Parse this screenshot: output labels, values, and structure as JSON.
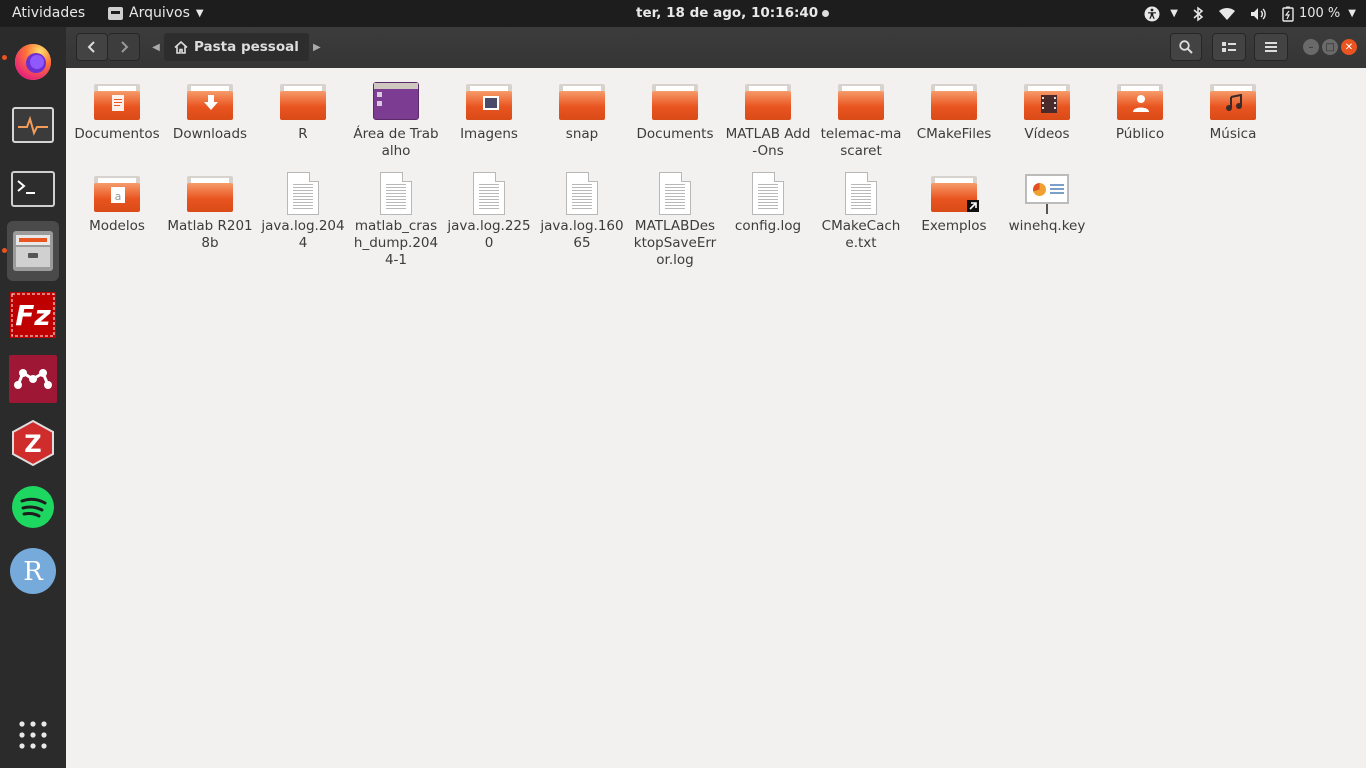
{
  "topbar": {
    "activities": "Atividades",
    "app_name": "Arquivos",
    "clock": "ter, 18 de ago, 10:16:40",
    "battery": "100 %"
  },
  "headerbar": {
    "location": "Pasta pessoal"
  },
  "dock": {
    "apps": [
      "firefox",
      "system-monitor",
      "terminal",
      "files",
      "filezilla",
      "mendeley",
      "zotero",
      "spotify",
      "rstudio",
      "show-applications"
    ]
  },
  "files": [
    {
      "name": "Documentos",
      "kind": "folder-documents"
    },
    {
      "name": "Downloads",
      "kind": "folder-downloads"
    },
    {
      "name": "R",
      "kind": "folder"
    },
    {
      "name": "Área de Trabalho",
      "kind": "desktop"
    },
    {
      "name": "Imagens",
      "kind": "folder-pictures"
    },
    {
      "name": "snap",
      "kind": "folder"
    },
    {
      "name": "Documents",
      "kind": "folder"
    },
    {
      "name": "MATLAB Add-Ons",
      "kind": "folder"
    },
    {
      "name": "telemac-mascaret",
      "kind": "folder"
    },
    {
      "name": "CMakeFiles",
      "kind": "folder"
    },
    {
      "name": "Vídeos",
      "kind": "folder-videos"
    },
    {
      "name": "Público",
      "kind": "folder-public"
    },
    {
      "name": "Música",
      "kind": "folder-music"
    },
    {
      "name": "Modelos",
      "kind": "folder-templates"
    },
    {
      "name": "Matlab R2018b",
      "kind": "folder"
    },
    {
      "name": "java.log.2044",
      "kind": "text"
    },
    {
      "name": "matlab_crash_dump.2044-1",
      "kind": "text"
    },
    {
      "name": "java.log.2250",
      "kind": "text"
    },
    {
      "name": "java.log.16065",
      "kind": "text"
    },
    {
      "name": "MATLABDesktopSaveError.log",
      "kind": "text"
    },
    {
      "name": "config.log",
      "kind": "text"
    },
    {
      "name": "CMakeCache.txt",
      "kind": "text"
    },
    {
      "name": "Exemplos",
      "kind": "folder-link"
    },
    {
      "name": "winehq.key",
      "kind": "presentation"
    }
  ]
}
